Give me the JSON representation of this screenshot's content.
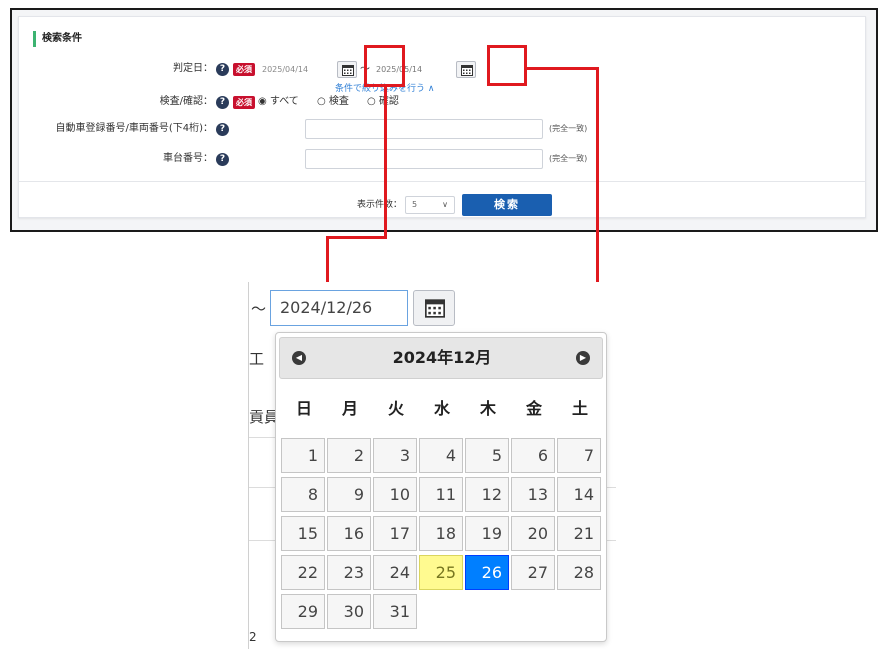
{
  "search_panel": {
    "title": "検索条件",
    "judgment_date": {
      "label": "判定日：",
      "required": "必須",
      "from_value": "2025/04/14",
      "separator": "～",
      "to_value": "2025/05/14"
    },
    "filter_link": "条件で絞り込みを行う ∧",
    "inspection": {
      "label": "検査/確認：",
      "required": "必須",
      "options": [
        "すべて",
        "検査",
        "確認"
      ],
      "selected": "すべて"
    },
    "vehicle_number": {
      "label": "自動車登録番号/車両番号(下4桁)：",
      "value": "",
      "note": "(完全一致)"
    },
    "chassis_number": {
      "label": "車台番号：",
      "value": "",
      "note": "(完全一致)"
    },
    "display_count": {
      "label": "表示件数：",
      "value": "5"
    },
    "search_button": "検索"
  },
  "zoom": {
    "tilde": "～",
    "date_input_value": "2024/12/26",
    "bg_fragments": [
      "工",
      "貢員",
      "2"
    ],
    "datepicker": {
      "title": "2024年12月",
      "weekdays": [
        "日",
        "月",
        "火",
        "水",
        "木",
        "金",
        "土"
      ],
      "weeks": [
        [
          "",
          "",
          "",
          "",
          "",
          "",
          ""
        ],
        [
          "1",
          "2",
          "3",
          "4",
          "5",
          "6",
          "7"
        ],
        [
          "8",
          "9",
          "10",
          "11",
          "12",
          "13",
          "14"
        ],
        [
          "15",
          "16",
          "17",
          "18",
          "19",
          "20",
          "21"
        ],
        [
          "22",
          "23",
          "24",
          "25",
          "26",
          "27",
          "28"
        ],
        [
          "29",
          "30",
          "31"
        ]
      ],
      "today": "25",
      "selected": "26"
    }
  },
  "colors": {
    "highlight": "#e0191f",
    "accent_green": "#3cb371",
    "primary": "#1a5fb0",
    "selected_day": "#007fff",
    "today_day": "#fffa90"
  }
}
